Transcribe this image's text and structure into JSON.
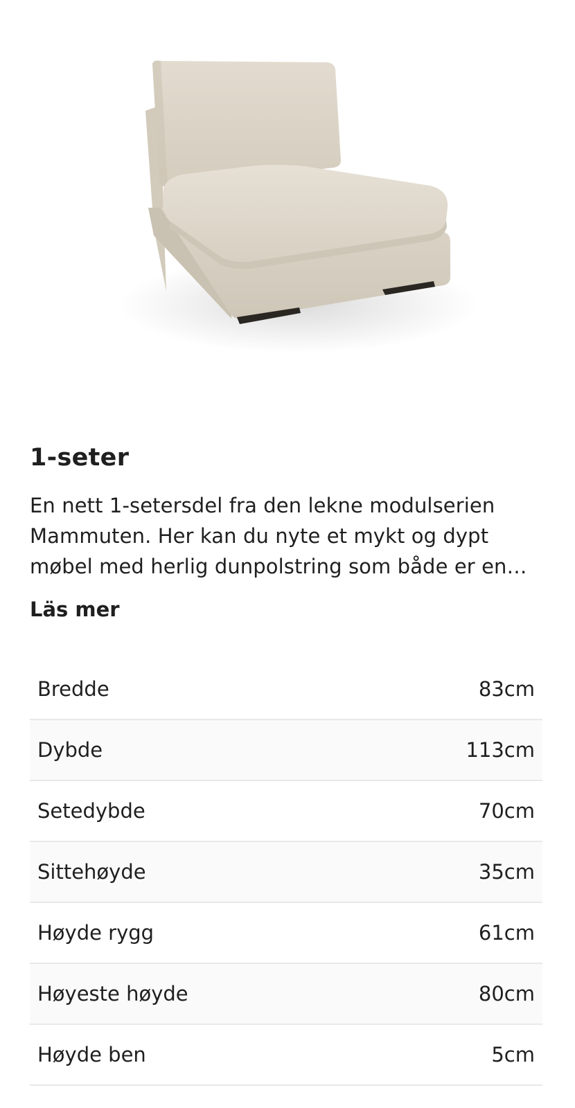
{
  "product": {
    "image_alt": "Armless 1-seater sofa module in light beige upholstery",
    "title": "1-seter",
    "description": "En nett 1-setersdel fra den lekne modulserien Mammuten. Her kan du nyte et mykt og dypt møbel med herlig dunpolstring som både er en…",
    "read_more_label": "Läs mer"
  },
  "specs": [
    {
      "label": "Bredde",
      "value": "83cm"
    },
    {
      "label": "Dybde",
      "value": "113cm"
    },
    {
      "label": "Setedybde",
      "value": "70cm"
    },
    {
      "label": "Sittehøyde",
      "value": "35cm"
    },
    {
      "label": "Høyde rygg",
      "value": "61cm"
    },
    {
      "label": "Høyeste høyde",
      "value": "80cm"
    },
    {
      "label": "Høyde ben",
      "value": "5cm"
    }
  ],
  "colors": {
    "fabric": "#ddd6c9",
    "fabric_shadow": "#cfc7b8",
    "legs": "#2a2622",
    "divider": "#e8e8e8",
    "row_alt": "#fafafa"
  }
}
